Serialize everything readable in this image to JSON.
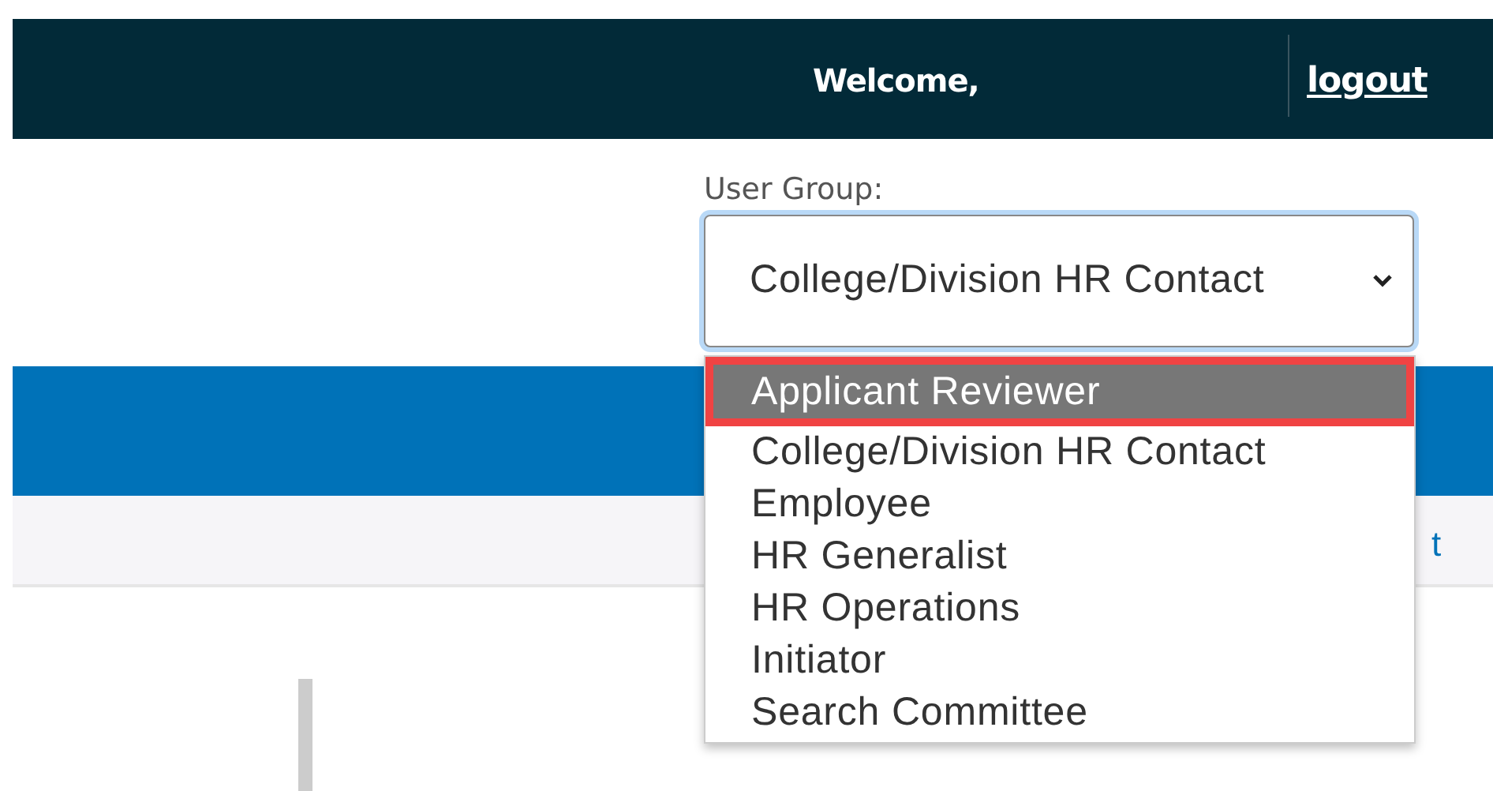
{
  "header": {
    "welcome": "Welcome,",
    "logout": "logout"
  },
  "user_group": {
    "label": "User Group:",
    "value": "College/Division HR Contact",
    "options": [
      {
        "label": "Applicant Reviewer",
        "highlighted": true,
        "annotated": true
      },
      {
        "label": "College/Division HR Contact",
        "highlighted": false,
        "annotated": false
      },
      {
        "label": "Employee",
        "highlighted": false,
        "annotated": false
      },
      {
        "label": "HR Generalist",
        "highlighted": false,
        "annotated": false
      },
      {
        "label": "HR Operations",
        "highlighted": false,
        "annotated": false
      },
      {
        "label": "Initiator",
        "highlighted": false,
        "annotated": false
      },
      {
        "label": "Search Committee",
        "highlighted": false,
        "annotated": false
      }
    ]
  },
  "toolbar": {
    "link": "t"
  }
}
